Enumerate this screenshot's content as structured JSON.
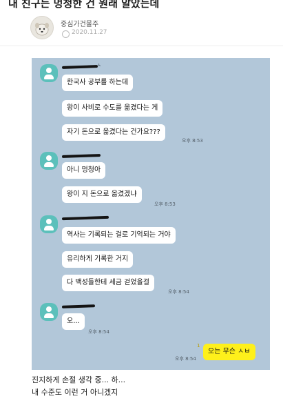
{
  "post": {
    "title": "내 친구는 멍청한 건 원래 알았는데",
    "author": "중심가건물주",
    "date": "2020.11.27"
  },
  "chat": {
    "groups": [
      {
        "sender": "ㅅ",
        "messages": [
          "한국사 공부를 하는데",
          "왕이 사비로 수도를 옮겼다는 게",
          "자기 돈으로 옮겼다는 건가요???"
        ],
        "time": "오후 8:53"
      },
      {
        "sender": "",
        "messages": [
          "아니 멍청아",
          "왕이 지 돈으로 옮겼겠냐"
        ],
        "time": "오후 8:53"
      },
      {
        "sender": "",
        "messages": [
          "역사는 기록되는 걸로 기억되는 거야",
          "유리하게 기록한 거지",
          "다 백성들한테 세금 걷었을걸"
        ],
        "time": "오후 8:54"
      },
      {
        "sender": "",
        "messages": [
          "오..."
        ],
        "time": "오후 8:54"
      }
    ],
    "my_message": {
      "text": "오는 무슨 ㅅㅂ",
      "time": "오후 8:54",
      "read_count": "1"
    }
  },
  "closing": {
    "line1": "진지하게 손절 생각 중... 하...",
    "line2": "내 수준도 이런 거 아니겠지"
  },
  "colors": {
    "chat_background": "#b2c7d9",
    "my_bubble": "#fef01b",
    "profile": "#5cc0bb"
  }
}
